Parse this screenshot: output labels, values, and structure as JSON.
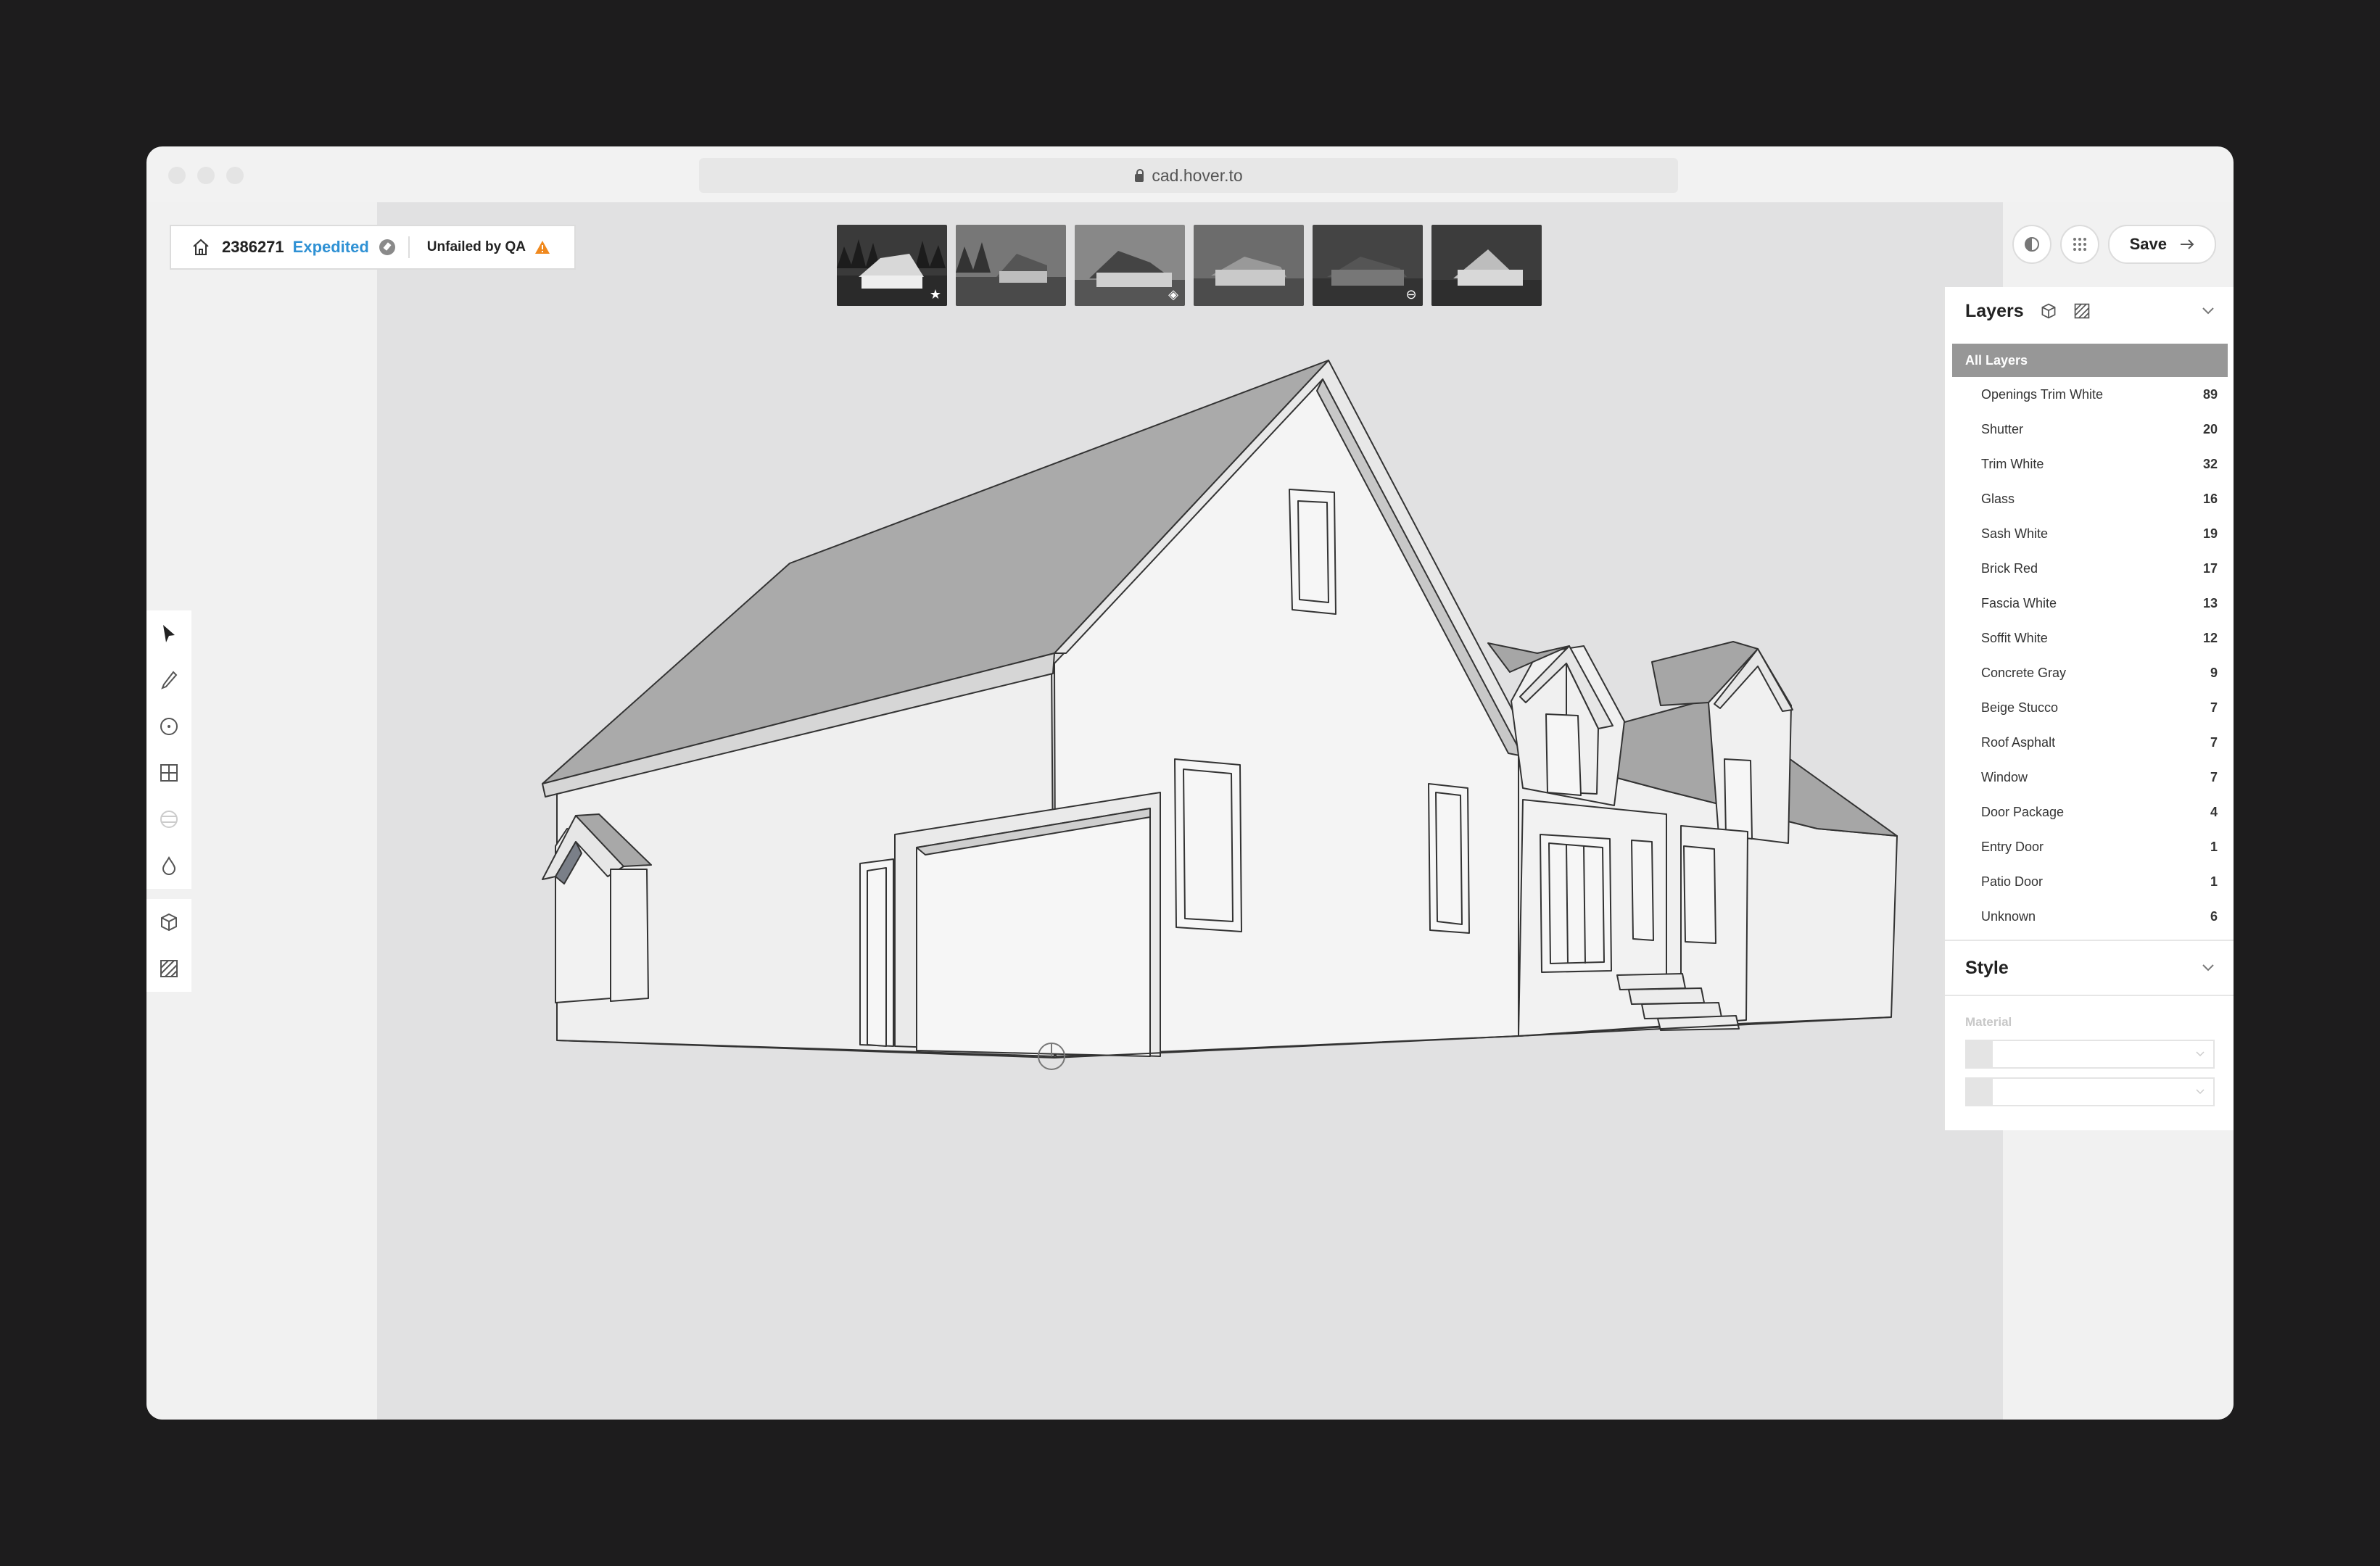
{
  "browser": {
    "url": "cad.hover.to"
  },
  "job": {
    "id": "2386271",
    "priority": "Expedited",
    "qa_status": "Unfailed by QA"
  },
  "thumbnails": [
    {
      "badge": "star-icon"
    },
    {
      "badge": ""
    },
    {
      "badge": "layers-icon"
    },
    {
      "badge": ""
    },
    {
      "badge": "minus-icon"
    },
    {
      "badge": ""
    }
  ],
  "header_actions": {
    "save_label": "Save"
  },
  "layers_panel": {
    "title": "Layers",
    "all_label": "All Layers",
    "items": [
      {
        "name": "Openings Trim White",
        "count": "89"
      },
      {
        "name": "Shutter",
        "count": "20"
      },
      {
        "name": "Trim White",
        "count": "32"
      },
      {
        "name": "Glass",
        "count": "16"
      },
      {
        "name": "Sash White",
        "count": "19"
      },
      {
        "name": "Brick Red",
        "count": "17"
      },
      {
        "name": "Fascia White",
        "count": "13"
      },
      {
        "name": "Soffit White",
        "count": "12"
      },
      {
        "name": "Concrete Gray",
        "count": "9"
      },
      {
        "name": "Beige Stucco",
        "count": "7"
      },
      {
        "name": "Roof Asphalt",
        "count": "7"
      },
      {
        "name": "Window",
        "count": "7"
      },
      {
        "name": "Door Package",
        "count": "4"
      },
      {
        "name": "Entry Door",
        "count": "1"
      },
      {
        "name": "Patio Door",
        "count": "1"
      },
      {
        "name": "Unknown",
        "count": "6"
      }
    ]
  },
  "style_panel": {
    "title": "Style",
    "material_label": "Material"
  },
  "colors": {
    "accent": "#2f91d4",
    "warning": "#f0891e",
    "selected_layer": "#979797"
  }
}
